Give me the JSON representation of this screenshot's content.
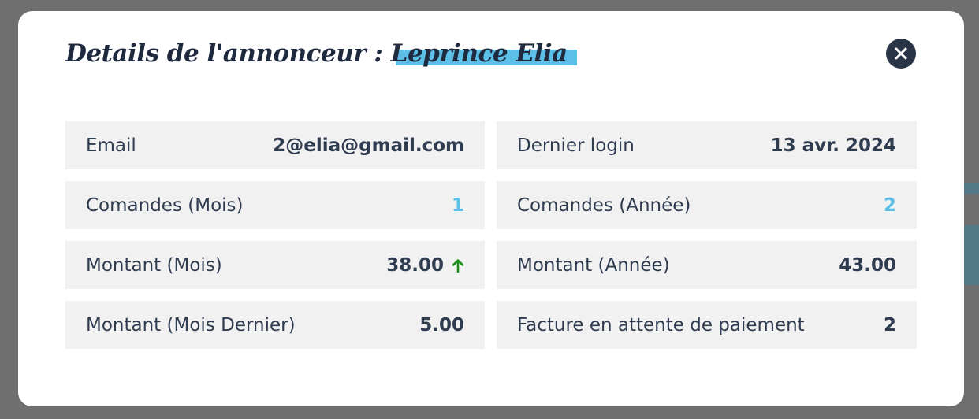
{
  "modal": {
    "title_prefix": "Details de l'annonceur : ",
    "advertiser_name": "Leprince Elia",
    "close_icon": "close-icon"
  },
  "colors": {
    "accent": "#5bbfe8",
    "heading": "#1f2a3e",
    "close_button_bg": "#2a3447",
    "cell_bg": "#f1f1f1",
    "trend_up": "#1a8a1a"
  },
  "details": {
    "email": {
      "label": "Email",
      "value": "2@elia@gmail.com"
    },
    "last_login": {
      "label": "Dernier login",
      "value": "13 avr. 2024"
    },
    "orders_month": {
      "label": "Comandes (Mois)",
      "value": "1"
    },
    "orders_year": {
      "label": "Comandes (Année)",
      "value": "2"
    },
    "amount_month": {
      "label": "Montant (Mois)",
      "value": "38.00",
      "trend_icon": "arrow-up-icon"
    },
    "amount_year": {
      "label": "Montant (Année)",
      "value": "43.00"
    },
    "amount_last_month": {
      "label": "Montant (Mois Dernier)",
      "value": "5.00"
    },
    "pending_invoices": {
      "label": "Facture en attente de paiement",
      "value": "2"
    }
  }
}
